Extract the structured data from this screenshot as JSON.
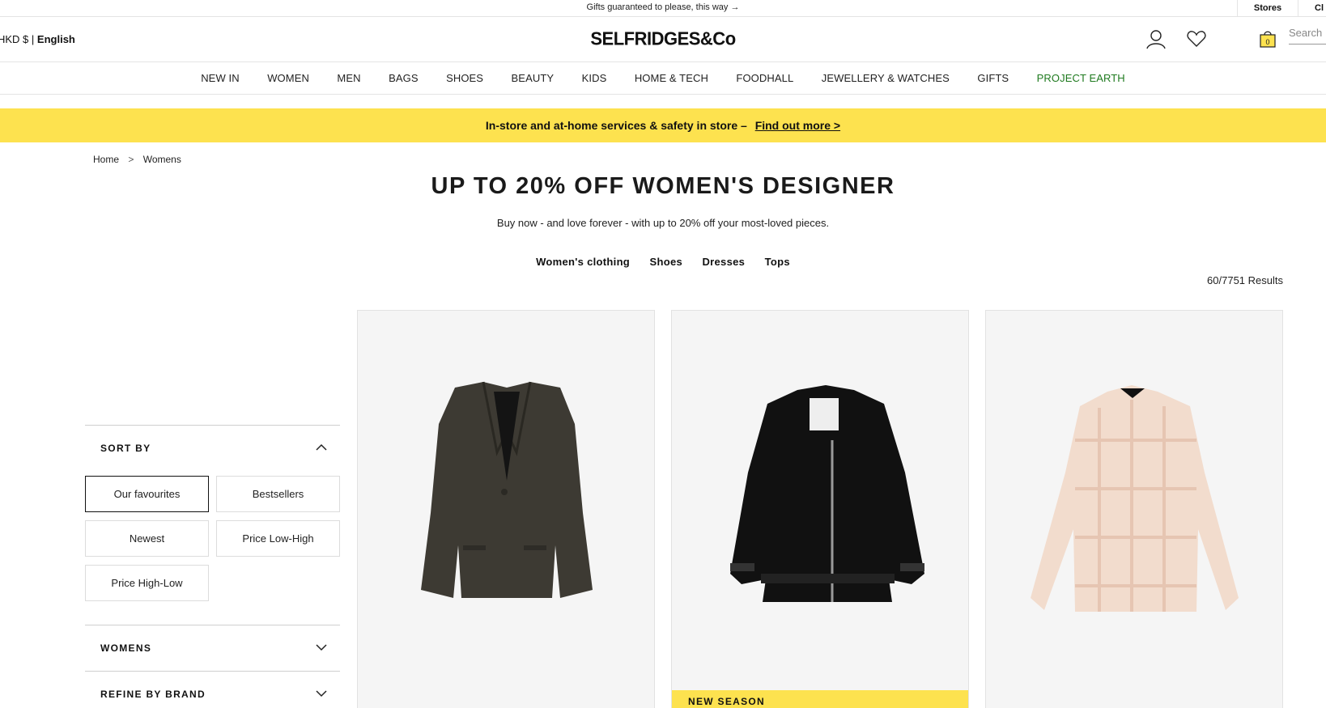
{
  "topbar": {
    "message": "Gifts guaranteed to please, this way →",
    "stores_label": "Stores",
    "cl_label": "Cl"
  },
  "header": {
    "currency": "HKD $",
    "language": "English",
    "logo": "SELFRIDGES&Co",
    "bag_count": "0",
    "search_placeholder": "Search"
  },
  "nav": {
    "items": [
      "NEW IN",
      "WOMEN",
      "MEN",
      "BAGS",
      "SHOES",
      "BEAUTY",
      "KIDS",
      "HOME & TECH",
      "FOODHALL",
      "JEWELLERY & WATCHES",
      "GIFTS",
      "PROJECT EARTH"
    ]
  },
  "banner": {
    "text": "In-store and at-home services & safety in store –",
    "link": "Find out more >"
  },
  "breadcrumb": {
    "home": "Home",
    "separator": ">",
    "current": "Womens"
  },
  "page": {
    "title": "UP TO 20% OFF WOMEN'S DESIGNER",
    "subtitle": "Buy now - and love forever - with up to 20% off your most-loved pieces.",
    "chips": [
      "Women's clothing",
      "Shoes",
      "Dresses",
      "Tops"
    ],
    "results": "60/7751 Results"
  },
  "filters": {
    "sort_by": "SORT BY",
    "sort_options": [
      "Our favourites",
      "Bestsellers",
      "Newest",
      "Price Low-High",
      "Price High-Low"
    ],
    "sort_selected": "Our favourites",
    "womens": "WOMENS",
    "refine_brand": "REFINE BY BRAND"
  },
  "products": [
    {
      "image": "dark-brown-blazer",
      "badge": ""
    },
    {
      "image": "black-shearling-jacket",
      "badge": "NEW SEASON"
    },
    {
      "image": "pink-check-shirt",
      "badge": ""
    }
  ],
  "colors": {
    "accent_yellow": "#fde24f",
    "project_earth_green": "#1f7a1f"
  }
}
